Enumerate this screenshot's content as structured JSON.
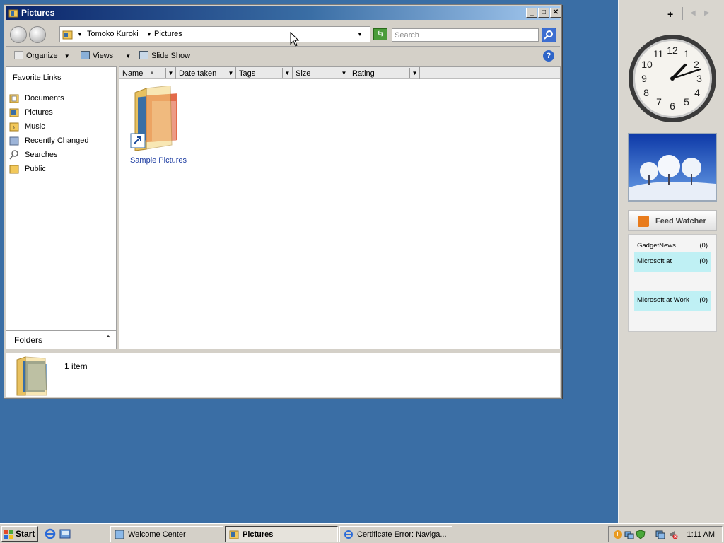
{
  "window": {
    "title": "Pictures",
    "minimize": "_",
    "maximize": "□",
    "close": "✕",
    "breadcrumb": [
      "Tomoko Kuroki",
      "Pictures"
    ],
    "search_placeholder": "Search",
    "toolbar": {
      "organize": "Organize",
      "views": "Views",
      "slideshow": "Slide Show",
      "help": "?"
    },
    "favorites_title": "Favorite Links",
    "favorites": [
      {
        "label": "Documents",
        "icon": "documents-folder-icon"
      },
      {
        "label": "Pictures",
        "icon": "pictures-folder-icon"
      },
      {
        "label": "Music",
        "icon": "music-folder-icon"
      },
      {
        "label": "Recently Changed",
        "icon": "recent-folder-icon"
      },
      {
        "label": "Searches",
        "icon": "search-magnifier-icon"
      },
      {
        "label": "Public",
        "icon": "public-folder-icon"
      }
    ],
    "folders_label": "Folders",
    "columns": [
      "Name",
      "Date taken",
      "Tags",
      "Size",
      "Rating"
    ],
    "items": [
      {
        "name": "Sample Pictures",
        "type": "folder-shortcut"
      }
    ],
    "details": {
      "count": "1 item"
    }
  },
  "sidebar": {
    "add_label": "+",
    "feed": {
      "title": "Feed Watcher",
      "rows": [
        {
          "name": "GadgetNews",
          "count": "(0)",
          "highlight": false
        },
        {
          "name": "Microsoft at",
          "count": "(0)",
          "highlight": true
        },
        {
          "name": "Microsoft at Work",
          "count": "(0)",
          "highlight": true
        }
      ]
    },
    "clock_numbers": [
      "12",
      "1",
      "2",
      "3",
      "4",
      "5",
      "6",
      "7",
      "8",
      "9",
      "10",
      "11"
    ]
  },
  "taskbar": {
    "start_label": "Start",
    "tasks": [
      {
        "label": "Welcome Center",
        "active": false
      },
      {
        "label": "Pictures",
        "active": true
      },
      {
        "label": "Certificate Error: Naviga...",
        "active": false
      }
    ],
    "time": "1:11 AM"
  },
  "colors": {
    "desktop": "#3a6ea5",
    "title_start": "#0a246a",
    "feed_highlight": "#bff0f4",
    "link": "#1a3aa0"
  }
}
